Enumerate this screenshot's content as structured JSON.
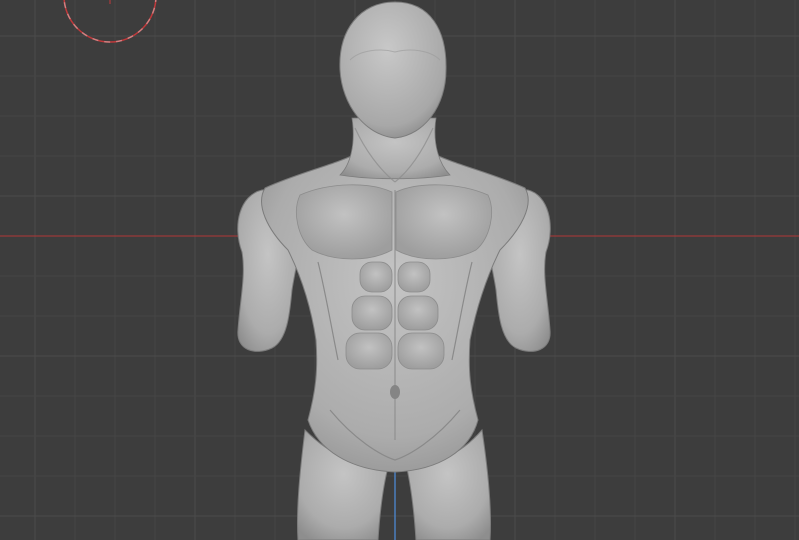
{
  "viewport": {
    "background_color": "#3d3d3d",
    "grid_minor_color": "#454545",
    "grid_major_color": "#4a4a4a",
    "x_axis_color": "#9a3a3a",
    "z_axis_color": "#4b7fbf",
    "gizmo_circle_color": "#c0393b",
    "mesh_color": "#b4b4b4"
  },
  "scene": {
    "object": "sculpted-male-torso-mesh",
    "shading": "solid"
  }
}
